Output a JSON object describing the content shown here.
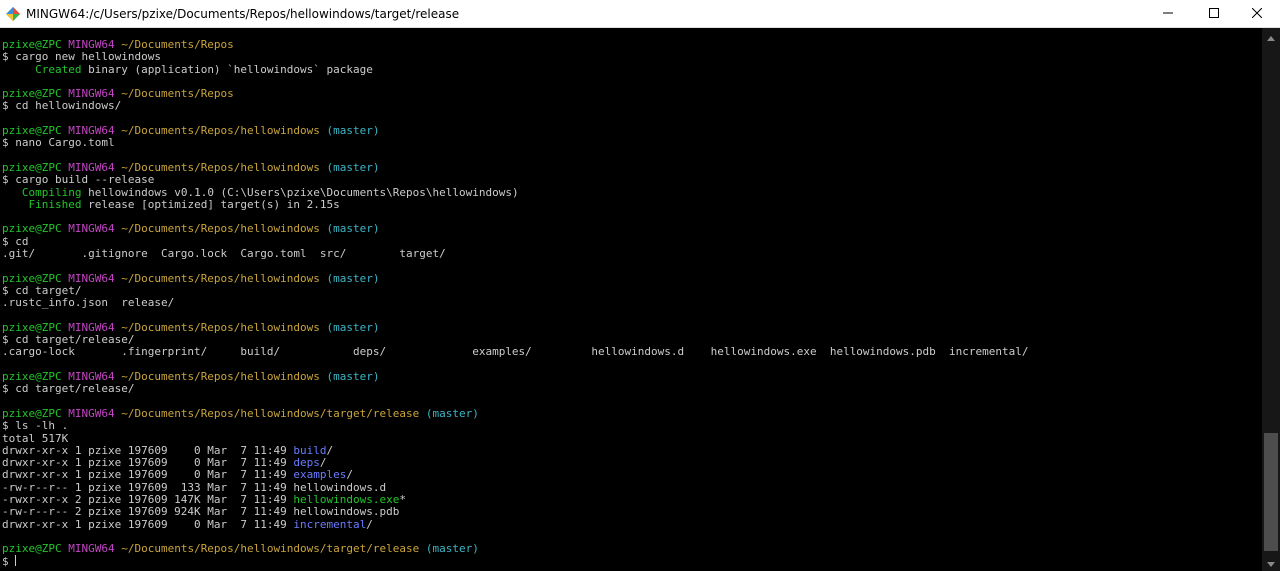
{
  "window": {
    "title": "MINGW64:/c/Users/pzixe/Documents/Repos/hellowindows/target/release"
  },
  "colors": {
    "user_host": "#22c52a",
    "msystem": "#c344c3",
    "path": "#c9a53a",
    "branch": "#3cb5c6",
    "directory": "#6a7bff",
    "executable": "#22c52a",
    "text": "#cccccc",
    "background": "#000000"
  },
  "icons": {
    "app": "mingw-app-icon",
    "minimize": "minimize-icon",
    "maximize": "maximize-icon",
    "close": "close-icon",
    "scroll_up": "scroll-up-arrow-icon",
    "scroll_down": "scroll-down-arrow-icon"
  },
  "terminal": {
    "lines": [
      [
        {
          "t": "pzixe@ZPC",
          "c": "g"
        },
        {
          "t": " ",
          "c": "w"
        },
        {
          "t": "MINGW64",
          "c": "m"
        },
        {
          "t": " ",
          "c": "w"
        },
        {
          "t": "~/Documents/Repos",
          "c": "y"
        }
      ],
      [
        {
          "t": "$ cargo new hellowindows",
          "c": "w"
        }
      ],
      [
        {
          "t": "     ",
          "c": "w"
        },
        {
          "t": "Created",
          "c": "g"
        },
        {
          "t": " binary (application) `hellowindows` package",
          "c": "w"
        }
      ],
      [],
      [
        {
          "t": "pzixe@ZPC",
          "c": "g"
        },
        {
          "t": " ",
          "c": "w"
        },
        {
          "t": "MINGW64",
          "c": "m"
        },
        {
          "t": " ",
          "c": "w"
        },
        {
          "t": "~/Documents/Repos",
          "c": "y"
        }
      ],
      [
        {
          "t": "$ cd hellowindows/",
          "c": "w"
        }
      ],
      [],
      [
        {
          "t": "pzixe@ZPC",
          "c": "g"
        },
        {
          "t": " ",
          "c": "w"
        },
        {
          "t": "MINGW64",
          "c": "m"
        },
        {
          "t": " ",
          "c": "w"
        },
        {
          "t": "~/Documents/Repos/hellowindows",
          "c": "y"
        },
        {
          "t": " (master)",
          "c": "c"
        }
      ],
      [
        {
          "t": "$ nano Cargo.toml",
          "c": "w"
        }
      ],
      [],
      [
        {
          "t": "pzixe@ZPC",
          "c": "g"
        },
        {
          "t": " ",
          "c": "w"
        },
        {
          "t": "MINGW64",
          "c": "m"
        },
        {
          "t": " ",
          "c": "w"
        },
        {
          "t": "~/Documents/Repos/hellowindows",
          "c": "y"
        },
        {
          "t": " (master)",
          "c": "c"
        }
      ],
      [
        {
          "t": "$ cargo build --release",
          "c": "w"
        }
      ],
      [
        {
          "t": "   ",
          "c": "w"
        },
        {
          "t": "Compiling",
          "c": "g"
        },
        {
          "t": " hellowindows v0.1.0 (C:\\Users\\pzixe\\Documents\\Repos\\hellowindows)",
          "c": "w"
        }
      ],
      [
        {
          "t": "    ",
          "c": "w"
        },
        {
          "t": "Finished",
          "c": "g"
        },
        {
          "t": " release [optimized] target(s) in 2.15s",
          "c": "w"
        }
      ],
      [],
      [
        {
          "t": "pzixe@ZPC",
          "c": "g"
        },
        {
          "t": " ",
          "c": "w"
        },
        {
          "t": "MINGW64",
          "c": "m"
        },
        {
          "t": " ",
          "c": "w"
        },
        {
          "t": "~/Documents/Repos/hellowindows",
          "c": "y"
        },
        {
          "t": " (master)",
          "c": "c"
        }
      ],
      [
        {
          "t": "$ cd",
          "c": "w"
        }
      ],
      [
        {
          "t": ".git/       .gitignore  Cargo.lock  Cargo.toml  src/        target/",
          "c": "w"
        }
      ],
      [],
      [
        {
          "t": "pzixe@ZPC",
          "c": "g"
        },
        {
          "t": " ",
          "c": "w"
        },
        {
          "t": "MINGW64",
          "c": "m"
        },
        {
          "t": " ",
          "c": "w"
        },
        {
          "t": "~/Documents/Repos/hellowindows",
          "c": "y"
        },
        {
          "t": " (master)",
          "c": "c"
        }
      ],
      [
        {
          "t": "$ cd target/",
          "c": "w"
        }
      ],
      [
        {
          "t": ".rustc_info.json  release/",
          "c": "w"
        }
      ],
      [],
      [
        {
          "t": "pzixe@ZPC",
          "c": "g"
        },
        {
          "t": " ",
          "c": "w"
        },
        {
          "t": "MINGW64",
          "c": "m"
        },
        {
          "t": " ",
          "c": "w"
        },
        {
          "t": "~/Documents/Repos/hellowindows",
          "c": "y"
        },
        {
          "t": " (master)",
          "c": "c"
        }
      ],
      [
        {
          "t": "$ cd target/release/",
          "c": "w"
        }
      ],
      [
        {
          "t": ".cargo-lock       .fingerprint/     build/           deps/             examples/         hellowindows.d    hellowindows.exe  hellowindows.pdb  incremental/",
          "c": "w"
        }
      ],
      [],
      [
        {
          "t": "pzixe@ZPC",
          "c": "g"
        },
        {
          "t": " ",
          "c": "w"
        },
        {
          "t": "MINGW64",
          "c": "m"
        },
        {
          "t": " ",
          "c": "w"
        },
        {
          "t": "~/Documents/Repos/hellowindows",
          "c": "y"
        },
        {
          "t": " (master)",
          "c": "c"
        }
      ],
      [
        {
          "t": "$ cd target/release/",
          "c": "w"
        }
      ],
      [],
      [
        {
          "t": "pzixe@ZPC",
          "c": "g"
        },
        {
          "t": " ",
          "c": "w"
        },
        {
          "t": "MINGW64",
          "c": "m"
        },
        {
          "t": " ",
          "c": "w"
        },
        {
          "t": "~/Documents/Repos/hellowindows/target/release",
          "c": "y"
        },
        {
          "t": " (master)",
          "c": "c"
        }
      ],
      [
        {
          "t": "$ ls -lh .",
          "c": "w"
        }
      ],
      [
        {
          "t": "total 517K",
          "c": "w"
        }
      ],
      [
        {
          "t": "drwxr-xr-x 1 pzixe 197609    0 Mar  7 11:49 ",
          "c": "w"
        },
        {
          "t": "build",
          "c": "b"
        },
        {
          "t": "/",
          "c": "w"
        }
      ],
      [
        {
          "t": "drwxr-xr-x 1 pzixe 197609    0 Mar  7 11:49 ",
          "c": "w"
        },
        {
          "t": "deps",
          "c": "b"
        },
        {
          "t": "/",
          "c": "w"
        }
      ],
      [
        {
          "t": "drwxr-xr-x 1 pzixe 197609    0 Mar  7 11:49 ",
          "c": "w"
        },
        {
          "t": "examples",
          "c": "b"
        },
        {
          "t": "/",
          "c": "w"
        }
      ],
      [
        {
          "t": "-rw-r--r-- 1 pzixe 197609  133 Mar  7 11:49 hellowindows.d",
          "c": "w"
        }
      ],
      [
        {
          "t": "-rwxr-xr-x 2 pzixe 197609 147K Mar  7 11:49 ",
          "c": "w"
        },
        {
          "t": "hellowindows.exe",
          "c": "g"
        },
        {
          "t": "*",
          "c": "w"
        }
      ],
      [
        {
          "t": "-rw-r--r-- 2 pzixe 197609 924K Mar  7 11:49 hellowindows.pdb",
          "c": "w"
        }
      ],
      [
        {
          "t": "drwxr-xr-x 1 pzixe 197609    0 Mar  7 11:49 ",
          "c": "w"
        },
        {
          "t": "incremental",
          "c": "b"
        },
        {
          "t": "/",
          "c": "w"
        }
      ],
      [],
      [
        {
          "t": "pzixe@ZPC",
          "c": "g"
        },
        {
          "t": " ",
          "c": "w"
        },
        {
          "t": "MINGW64",
          "c": "m"
        },
        {
          "t": " ",
          "c": "w"
        },
        {
          "t": "~/Documents/Repos/hellowindows/target/release",
          "c": "y"
        },
        {
          "t": " (master)",
          "c": "c"
        }
      ],
      [
        {
          "t": "$ ",
          "c": "w"
        }
      ]
    ]
  }
}
